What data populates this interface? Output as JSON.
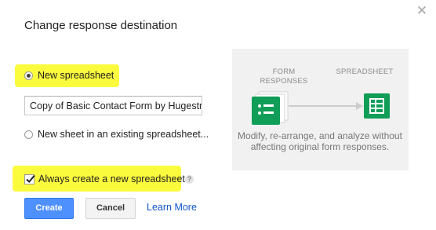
{
  "dialog": {
    "title": "Change response destination",
    "close_icon": "close-icon"
  },
  "options": {
    "new_spreadsheet": {
      "label": "New spreadsheet",
      "selected": true
    },
    "spreadsheet_name": {
      "value": "Copy of Basic Contact Form by Hugestr"
    },
    "existing_spreadsheet": {
      "label": "New sheet in an existing spreadsheet...",
      "selected": false
    },
    "always_create": {
      "label": "Always create a new spreadsheet",
      "checked": true,
      "help_icon": "help-icon"
    }
  },
  "buttons": {
    "create": "Create",
    "cancel": "Cancel",
    "learn_more": "Learn More"
  },
  "diagram": {
    "form_responses_caption": "FORM\nRESPONSES",
    "spreadsheet_caption": "SPREADSHEET",
    "description": "Modify, re-arrange, and analyze without affecting original form responses.",
    "icons": [
      "form-responses-icon",
      "arrow-icon",
      "spreadsheet-icon"
    ]
  },
  "colors": {
    "highlight": "#fbfb3d",
    "primary_button": "#4d90fe",
    "link": "#1155cc",
    "sheets_green": "#0f9d58"
  }
}
